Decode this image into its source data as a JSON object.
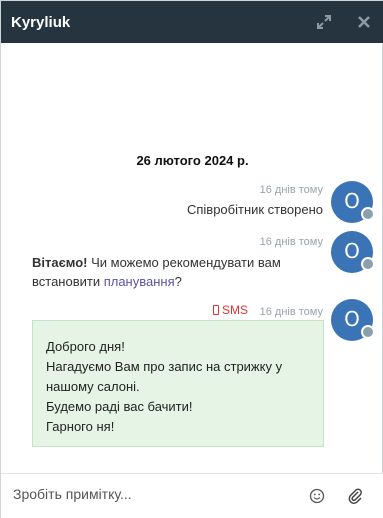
{
  "header": {
    "title": "Kyryliuk",
    "expand_icon": "expand-icon",
    "close_icon": "close-icon"
  },
  "date_separator": "26 лютого 2024 р.",
  "messages": [
    {
      "time": "16 днів тому",
      "text": "Співробітник створено",
      "avatar_letter": "O"
    },
    {
      "time": "16 днів тому",
      "greeting": "Вітаємо!",
      "text_before": " Чи можемо рекомендувати вам встановити ",
      "link": "планування",
      "text_after": "?",
      "avatar_letter": "O"
    },
    {
      "channel": "SMS",
      "time": "16 днів тому",
      "avatar_letter": "O",
      "lines": [
        "Доброго дня!",
        "Нагадуємо Вам про запис на стрижку у нашому салоні.",
        "Будемо раді вас бачити!",
        "Гарного ня!"
      ]
    }
  ],
  "composer": {
    "placeholder": "Зробіть примітку...",
    "emoji_icon": "smiley-icon",
    "attach_icon": "paperclip-icon"
  },
  "colors": {
    "header_bg": "#263440",
    "avatar": "#3a73b6",
    "sms_bubble": "#e5f4e5",
    "sms_label": "#dd3333",
    "link": "#5b53a3"
  }
}
